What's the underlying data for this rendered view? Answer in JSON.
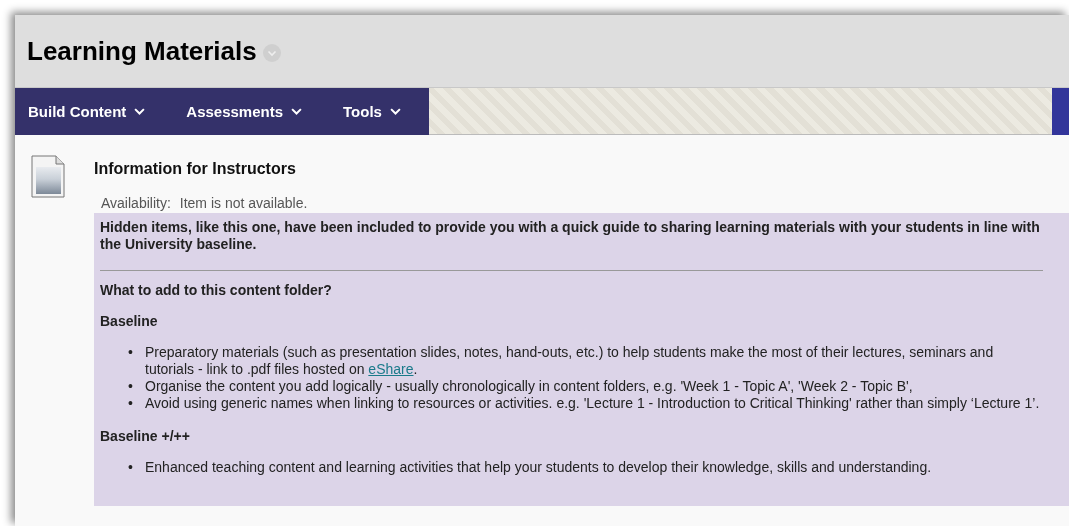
{
  "page_title": "Learning Materials",
  "action_bar": {
    "menus": [
      {
        "label": "Build Content"
      },
      {
        "label": "Assessments"
      },
      {
        "label": "Tools"
      }
    ]
  },
  "content_item": {
    "title": "Information for Instructors",
    "availability_label": "Availability:",
    "availability_value": "Item is not available.",
    "intro": "Hidden items, like this one, have been included to provide you with a quick guide to sharing learning materials with your students in line with the University baseline.",
    "question": "What to add to this content folder?",
    "sections": [
      {
        "heading": "Baseline",
        "items": [
          {
            "bullet": "•",
            "text": "Preparatory materials (such as presentation slides, notes, hand-outs, etc.) to help students make the most of their lectures, seminars and tutorials - link to .pdf files hosted on ",
            "link": "eShare",
            "after": "."
          },
          {
            "bullet": "•",
            "text": "Organise the content you add logically - usually chronologically in content folders, e.g. 'Week 1 - Topic A', 'Week 2 - Topic B',"
          },
          {
            "bullet": "•",
            "text": "Avoid using generic names when linking to resources or activities. e.g. 'Lecture 1 - Introduction to Critical Thinking' rather than simply ‘Lecture 1’."
          }
        ]
      },
      {
        "heading": "Baseline +/++",
        "items": [
          {
            "bullet": "•",
            "text": "Enhanced teaching content and learning activities that help your students to develop their knowledge, skills and understanding."
          }
        ]
      }
    ]
  }
}
